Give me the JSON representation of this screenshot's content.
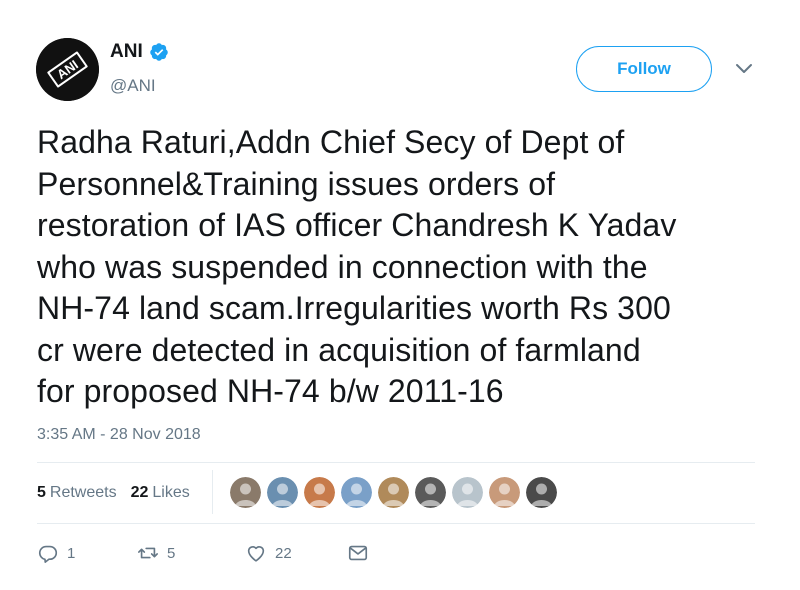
{
  "author": {
    "name": "ANI",
    "handle": "@ANI",
    "avatar_text": "ANI",
    "verified_icon": "verified-badge-icon"
  },
  "follow_label": "Follow",
  "tweet_text": "Radha Raturi,Addn Chief Secy of Dept of\nPersonnel&Training issues orders of\nrestoration of IAS officer Chandresh K Yadav\nwho was suspended in connection with the\nNH-74 land scam.Irregularities worth Rs 300\ncr were detected in acquisition of farmland\nfor proposed NH-74 b/w 2011-16",
  "timestamp": "3:35 AM - 28 Nov 2018",
  "stats": {
    "retweets_count": "5",
    "retweets_label": "Retweets",
    "likes_count": "22",
    "likes_label": "Likes"
  },
  "liker_avatars": [
    "#8a7a6a",
    "#6a8fb0",
    "#c77a4a",
    "#7aa0c8",
    "#b08a5a",
    "#5a5a5a",
    "#b8c4cc",
    "#c89a7a",
    "#4a4a4a"
  ],
  "actions": {
    "reply_count": "1",
    "retweet_count": "5",
    "like_count": "22"
  },
  "colors": {
    "accent": "#1da1f2",
    "text": "#14171a",
    "muted": "#657786"
  }
}
